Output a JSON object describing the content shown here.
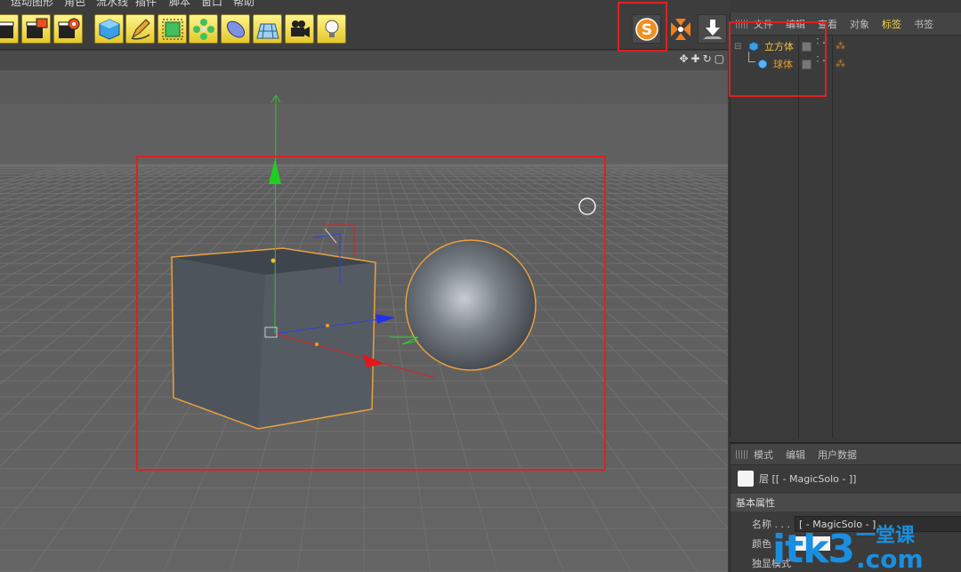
{
  "menu": [
    "运动图形",
    "角色",
    "流水线",
    "插件",
    "脚本",
    "窗口",
    "帮助"
  ],
  "toolbar": {
    "buttons": [
      "render-view",
      "render-picture-viewer",
      "render-settings",
      "cube",
      "pen",
      "subdivision",
      "array-clone",
      "bend-deformer",
      "floor",
      "camera",
      "light"
    ],
    "plugins": [
      "magicsolo",
      "magic-center",
      "magic-drop"
    ]
  },
  "viewport": {
    "nav_icons": [
      "✥",
      "✚",
      "↻",
      "▢"
    ]
  },
  "object_manager": {
    "tabs": [
      "文件",
      "编辑",
      "查看",
      "对象",
      "标签",
      "书签"
    ],
    "active_tab": "标签",
    "objects": [
      {
        "name": "立方体",
        "color": "#f0c040"
      },
      {
        "name": "球体",
        "color": "#e8a020"
      }
    ]
  },
  "attribute_manager": {
    "tabs": [
      "模式",
      "编辑",
      "用户数据"
    ],
    "layer_title": "层 [[ - MagicSolo - ]]",
    "section": "基本属性",
    "fields": [
      {
        "label": "名称 . . .",
        "value": "[ - MagicSolo - ]"
      },
      {
        "label": "颜色",
        "value": ""
      },
      {
        "label": "独显模式",
        "value": ""
      }
    ]
  },
  "watermark": {
    "brand": "itk3",
    "tld": ".com",
    "tagline": "一堂课"
  },
  "colors": {
    "highlight": "#e02020",
    "selection": "#e8a040",
    "tab_active": "#f0d040"
  }
}
